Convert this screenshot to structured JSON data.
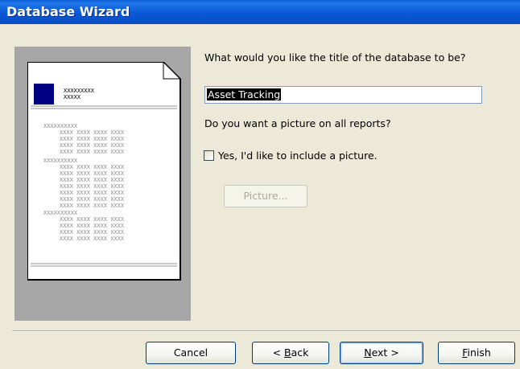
{
  "window": {
    "title": "Database Wizard"
  },
  "preview": {
    "header_line1": "XXXXXXXXX",
    "header_line2": "XXXXX",
    "group_header": "XXXXXXXXXX",
    "detail_row": "XXXX XXXX XXXX XXXX"
  },
  "form": {
    "title_prompt": "What would you like the title of the database to be?",
    "title_value": "Asset Tracking",
    "picture_prompt": "Do you want a picture on all reports?",
    "include_picture_label": "Yes, I'd like to include a picture.",
    "include_picture_checked": false,
    "picture_button_label": "Picture..."
  },
  "buttons": {
    "cancel": "Cancel",
    "back_mnemonic": "B",
    "back_prefix": "< ",
    "back_rest": "ack",
    "next_mnemonic": "N",
    "next_rest": "ext >",
    "finish_mnemonic": "F",
    "finish_rest": "inish"
  },
  "colors": {
    "title_bar": "#0A5FD8",
    "dialog_background": "#ECE9D8",
    "preview_background": "#A6A6A6",
    "logo_block": "#000080"
  }
}
